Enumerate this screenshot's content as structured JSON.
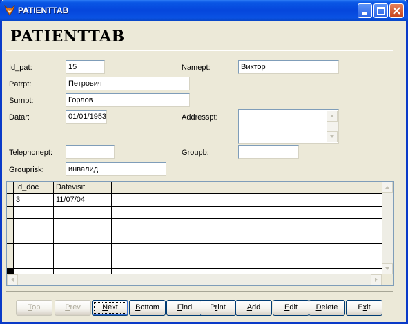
{
  "window": {
    "title": "PATIENTTAB"
  },
  "form": {
    "heading": "PATIENTTAB",
    "fields": {
      "id_pat": {
        "label": "Id_pat:",
        "value": "15"
      },
      "namept": {
        "label": "Namept:",
        "value": "Виктор"
      },
      "patrpt": {
        "label": "Patrpt:",
        "value": "Петрович"
      },
      "surnpt": {
        "label": "Surnpt:",
        "value": "Горлов"
      },
      "datar": {
        "label": "Datar:",
        "value": "01/01/1953"
      },
      "addresspt": {
        "label": "Addresspt:",
        "value": ""
      },
      "telephonept": {
        "label": "Telephonept:",
        "value": ""
      },
      "groupb": {
        "label": "Groupb:",
        "value": ""
      },
      "grouprisk": {
        "label": "Grouprisk:",
        "value": "инвалид"
      }
    }
  },
  "grid": {
    "columns": [
      "Id_doc",
      "Datevisit"
    ],
    "rows": [
      [
        "3",
        "11/07/04"
      ]
    ]
  },
  "buttons": {
    "top": {
      "label": "Top",
      "hotkey": "T",
      "rest": "op",
      "enabled": false
    },
    "prev": {
      "label": "Prev",
      "hotkey": "P",
      "rest": "rev",
      "enabled": false
    },
    "next": {
      "label": "Next",
      "hotkey": "N",
      "rest": "ext",
      "enabled": true
    },
    "bottom": {
      "label": "Bottom",
      "hotkey": "B",
      "rest": "ottom",
      "enabled": true
    },
    "find": {
      "label": "Find",
      "hotkey": "F",
      "rest": "ind",
      "enabled": true
    },
    "print": {
      "label": "Print",
      "pre": "P",
      "hotkey": "r",
      "rest": "int",
      "enabled": true
    },
    "add": {
      "label": "Add",
      "hotkey": "A",
      "rest": "dd",
      "enabled": true
    },
    "edit": {
      "label": "Edit",
      "hotkey": "E",
      "rest": "dit",
      "enabled": true
    },
    "delete": {
      "label": "Delete",
      "hotkey": "D",
      "rest": "elete",
      "enabled": true
    },
    "exit": {
      "label": "Exit",
      "pre": "E",
      "hotkey": "x",
      "rest": "it",
      "enabled": true
    }
  }
}
